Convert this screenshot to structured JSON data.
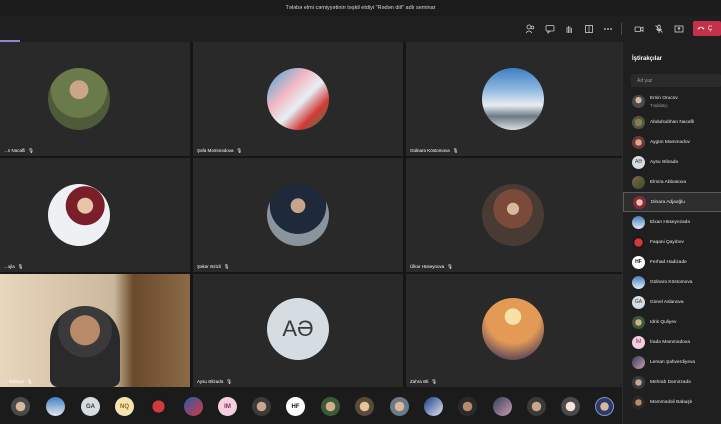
{
  "window": {
    "title": "Tələbə elmi cəmiyyətinin təşkil etdiyi \"Rədən dili\" adlı seminar"
  },
  "toolbar": {
    "icons": [
      "people-icon",
      "chat-icon",
      "raise-hand-icon",
      "rooms-icon",
      "more-icon",
      "camera-icon",
      "mic-icon",
      "share-icon",
      "phone-icon"
    ],
    "leave_label": "Ç"
  },
  "tiles": [
    {
      "name": "...n Nəcəfli"
    },
    {
      "name": "Şəfa Məmmədova"
    },
    {
      "name": "Gülnarə Köstomova"
    },
    {
      "name": "...ojla"
    },
    {
      "name": "Şəkər Əzizli"
    },
    {
      "name": "Ülkər Hüseynova"
    },
    {
      "name": "... Babaşlı"
    },
    {
      "name": "Aysu Əlizadə",
      "initials": "AƏ"
    },
    {
      "name": "Zəhra Əli"
    }
  ],
  "sidebar": {
    "title": "İştirakçılar",
    "search_placeholder": "Ad yaz",
    "participants": [
      {
        "name": "Emin Orucov",
        "role": "Təşkilatçı"
      },
      {
        "name": "Abdulsubhan Nacafli"
      },
      {
        "name": "Aygün Məmmədov"
      },
      {
        "name": "Aysu Əlizadə",
        "initials": "AƏ"
      },
      {
        "name": "Elmira Abbasova"
      },
      {
        "name": "Dinara Adjaoğlu"
      },
      {
        "name": "Elxan Hüseynzadə"
      },
      {
        "name": "Faqani Qayıbov"
      },
      {
        "name": "Ferhad Hadizade",
        "initials": "HF"
      },
      {
        "name": "Gülnarə Köstomova"
      },
      {
        "name": "Günel Aslanova",
        "initials": "GA"
      },
      {
        "name": "Idris Quliyev"
      },
      {
        "name": "İradə Məmmədova",
        "initials": "İM"
      },
      {
        "name": "Leman Şahverdiyeva"
      },
      {
        "name": "Mehrab Dəmirzadə"
      },
      {
        "name": "Məmmədəli Babaşlı"
      }
    ]
  },
  "strip": {
    "avatars": [
      {
        "initials": ""
      },
      {
        "initials": ""
      },
      {
        "initials": "GA"
      },
      {
        "initials": "NQ"
      },
      {
        "initials": ""
      },
      {
        "initials": ""
      },
      {
        "initials": "IM"
      },
      {
        "initials": ""
      },
      {
        "initials": "HF"
      },
      {
        "initials": ""
      },
      {
        "initials": ""
      },
      {
        "initials": ""
      },
      {
        "initials": ""
      },
      {
        "initials": ""
      },
      {
        "initials": ""
      },
      {
        "initials": ""
      },
      {
        "initials": ""
      },
      {
        "initials": ""
      }
    ]
  }
}
